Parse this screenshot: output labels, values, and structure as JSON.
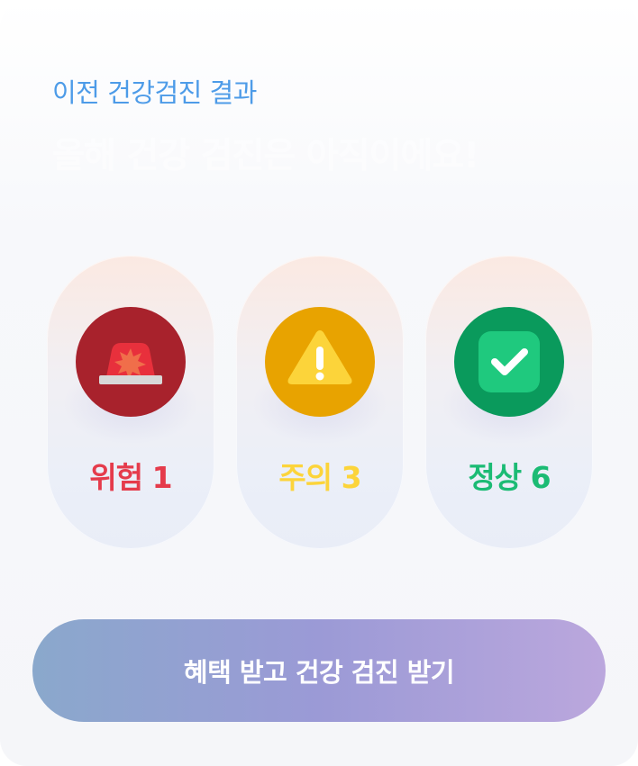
{
  "header": {
    "subtitle": "이전 건강검진 결과",
    "headline": "올해 건강 검진은 아직이에요!"
  },
  "results": [
    {
      "label": "위험 1",
      "status": "danger",
      "icon": "siren-icon",
      "color": "#e53b4b"
    },
    {
      "label": "주의 3",
      "status": "caution",
      "icon": "warning-icon",
      "color": "#fcd43a"
    },
    {
      "label": "정상 6",
      "status": "normal",
      "icon": "check-icon",
      "color": "#1bbb74"
    }
  ],
  "cta": {
    "label": "혜택 받고 건강 검진 받기"
  }
}
